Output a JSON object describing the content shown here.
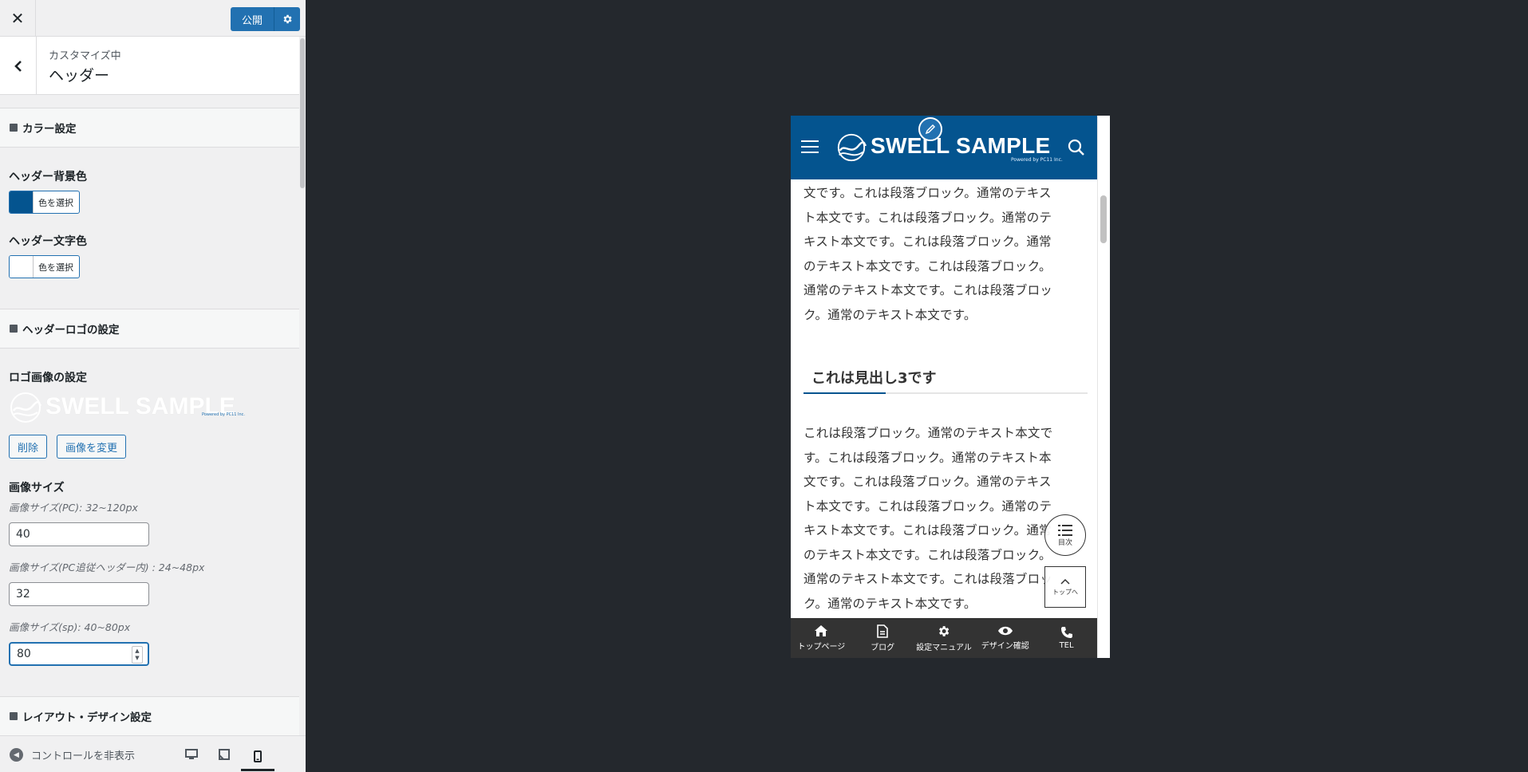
{
  "topbar": {
    "close_icon": "close-icon",
    "publish_label": "公開",
    "publish_settings_icon": "gear-icon"
  },
  "section": {
    "crumb": "カスタマイズ中",
    "title": "ヘッダー"
  },
  "color_group": {
    "title": "カラー設定",
    "bg_label": "ヘッダー背景色",
    "bg_color": "#04548f",
    "bg_button": "色を選択",
    "text_label": "ヘッダー文字色",
    "text_color": "#ffffff",
    "text_button": "色を選択"
  },
  "logo_group": {
    "title": "ヘッダーロゴの設定",
    "image_label": "ロゴ画像の設定",
    "logo_text": "SWELL SAMPLE",
    "logo_sub": "Powered by PC11 Inc.",
    "delete_button": "削除",
    "change_button": "画像を変更",
    "size_label": "画像サイズ",
    "pc_desc": "画像サイズ(PC): 32~120px",
    "pc_value": "40",
    "pc_follow_desc": "画像サイズ(PC追従ヘッダー内) : 24~48px",
    "pc_follow_value": "32",
    "sp_desc": "画像サイズ(sp): 40~80px",
    "sp_value": "80"
  },
  "layout_group": {
    "title": "レイアウト・デザイン設定"
  },
  "footer": {
    "hide_controls": "コントロールを非表示"
  },
  "preview": {
    "logo_text": "SWELL SAMPLE",
    "logo_sub": "Powered by PC11 Inc.",
    "para1": [
      "文です。これは段落ブロック。通常のテキス",
      "ト本文です。これは段落ブロック。通常のテ",
      "キスト本文です。これは段落ブロック。通常",
      "のテキスト本文です。これは段落ブロック。",
      "通常のテキスト本文です。これは段落ブロッ",
      "ク。通常のテキスト本文です。"
    ],
    "h3": "これは見出し3です",
    "para2": [
      "これは段落ブロック。通常のテキスト本文で",
      "す。これは段落ブロック。通常のテキスト本",
      "文です。これは段落ブロック。通常のテキス",
      "ト本文です。これは段落ブロック。通常のテ",
      "キスト本文です。これは段落ブロック。通常",
      "のテキスト本文です。これは段落ブロック。",
      "通常のテキスト本文です。これは段落ブロッ",
      "ク。通常のテキスト本文です。"
    ],
    "toc_label": "目次",
    "top_label": "トップへ",
    "fixbar": [
      {
        "label": "トップページ",
        "icon": "home-icon"
      },
      {
        "label": "ブログ",
        "icon": "document-icon"
      },
      {
        "label": "設定マニュアル",
        "icon": "gear-icon"
      },
      {
        "label": "デザイン確認",
        "icon": "eye-icon"
      },
      {
        "label": "TEL",
        "icon": "phone-icon"
      }
    ]
  }
}
